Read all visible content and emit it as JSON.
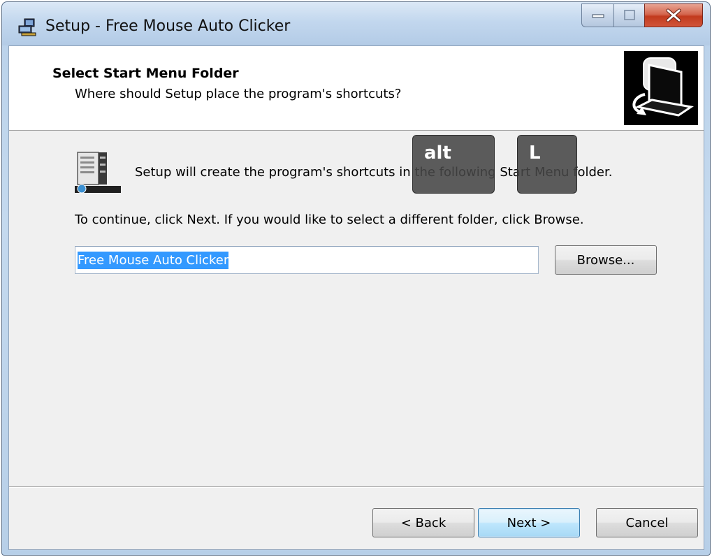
{
  "window": {
    "title": "Setup - Free Mouse Auto Clicker",
    "accent_titlebar": "#c2d7ee",
    "close_color": "#c23a1d"
  },
  "header": {
    "title": "Select Start Menu Folder",
    "subtitle": "Where should Setup place the program's shortcuts?",
    "image_icon": "computer-setup-icon"
  },
  "body": {
    "folder_icon": "start-menu-folder-icon",
    "line1": "Setup will create the program's shortcuts in the following Start Menu folder.",
    "line2": "To continue, click Next. If you would like to select a different folder, click Browse.",
    "folder_input_value": "Free Mouse Auto Clicker",
    "browse_label": "Browse..."
  },
  "footer": {
    "back_label": "< Back",
    "next_label": "Next >",
    "cancel_label": "Cancel"
  },
  "keys_overlay": {
    "key1": "alt",
    "key2": "L"
  }
}
